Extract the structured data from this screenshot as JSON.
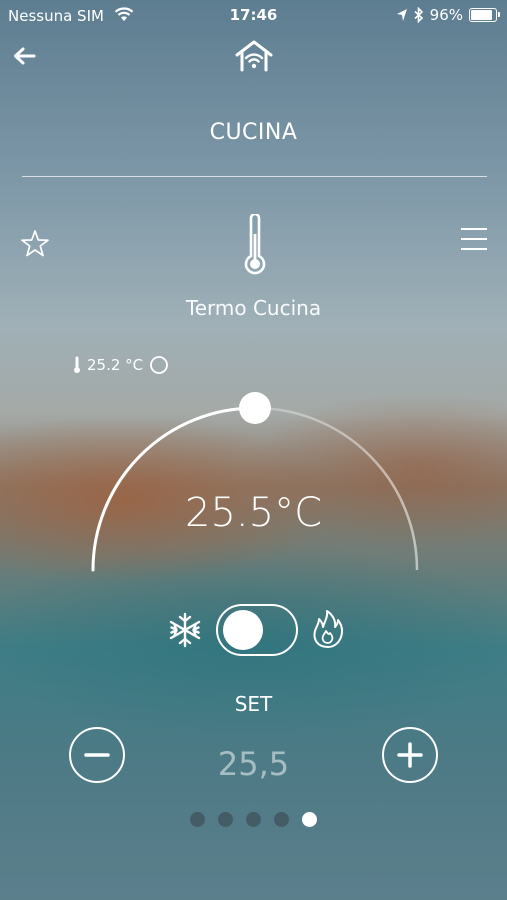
{
  "status_bar": {
    "carrier": "Nessuna SIM",
    "time": "17:46",
    "battery": "96%"
  },
  "header": {
    "back_icon": "arrow-left-icon",
    "home_icon": "smart-home-wifi-icon"
  },
  "room": {
    "title": "CUCINA"
  },
  "device": {
    "name": "Termo Cucina",
    "favorite_icon": "star-outline-icon",
    "menu_icon": "hamburger-menu-icon",
    "type_icon": "thermometer-icon",
    "current_temperature": "25.2 °C"
  },
  "thermostat": {
    "setpoint_display": "25.5°C",
    "dial_fraction": 0.5
  },
  "mode": {
    "cool_icon": "snowflake-icon",
    "heat_icon": "flame-icon",
    "toggle_state": "cool"
  },
  "set": {
    "label": "SET",
    "value": "25,5",
    "minus_icon": "minus-circle-icon",
    "plus_icon": "plus-circle-icon"
  },
  "pagination": {
    "count": 5,
    "active_index": 4
  }
}
